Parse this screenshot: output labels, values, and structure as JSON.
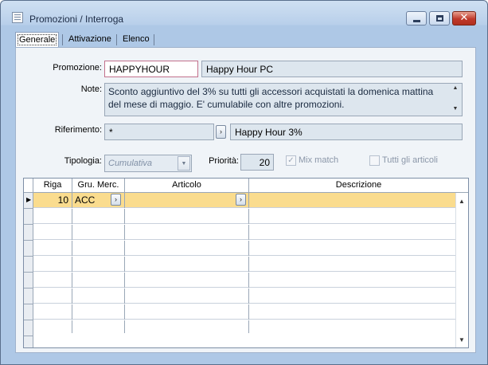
{
  "window": {
    "title": "Promozioni / Interroga",
    "close_glyph": "✕"
  },
  "tabs": [
    {
      "label": "Generale",
      "active": true
    },
    {
      "label": "Attivazione",
      "active": false
    },
    {
      "label": "Elenco",
      "active": false
    }
  ],
  "form": {
    "promozione_label": "Promozione:",
    "promozione_code": "HAPPYHOUR",
    "promozione_desc": "Happy Hour PC",
    "note_label": "Note:",
    "note_text": "Sconto aggiuntivo del 3% su tutti gli accessori acquistati la domenica mattina del mese di maggio. E' cumulabile con altre promozioni.",
    "riferimento_label": "Riferimento:",
    "riferimento_code": "*",
    "riferimento_desc": "Happy Hour 3%",
    "tipologia_label": "Tipologia:",
    "tipologia_value": "Cumulativa",
    "priorita_label": "Priorità:",
    "priorita_value": "20",
    "mix_match_label": "Mix match",
    "mix_match_checked": true,
    "tutti_articoli_label": "Tutti gli articoli",
    "tutti_articoli_checked": false
  },
  "grid": {
    "columns": [
      "Riga",
      "Gru. Merc.",
      "Articolo",
      "Descrizione"
    ],
    "rows": [
      {
        "riga": "10",
        "gru_merc": "ACC",
        "articolo": "",
        "descrizione": ""
      }
    ],
    "selected_color": "#fadc8e"
  },
  "glyphs": {
    "zoom": "›",
    "dropdown": "▼",
    "scroll_up": "▲",
    "scroll_down": "▼",
    "row_marker": "▶",
    "check": "✓"
  }
}
